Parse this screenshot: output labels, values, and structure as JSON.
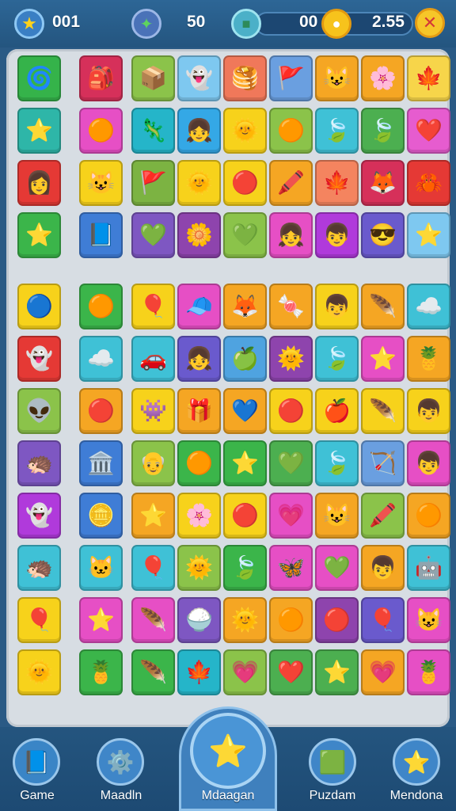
{
  "hud": {
    "score_label": "001",
    "moves_label": "50",
    "gold_label": "00",
    "time_label": "2.55",
    "icons": [
      "star-icon",
      "wrench-icon",
      "cube-icon",
      "gold-coin-icon",
      "close-icon"
    ]
  },
  "nav": {
    "items": [
      {
        "label": "Game",
        "icon": "book-icon"
      },
      {
        "label": "Maadln",
        "icon": "gear-icon"
      },
      {
        "label": "Mdaagan",
        "icon": "star-shield-icon"
      },
      {
        "label": "Puzdam",
        "icon": "puzzle-board-icon"
      },
      {
        "label": "Mendona",
        "icon": "star-icon"
      }
    ]
  },
  "board": {
    "rows": [
      [
        {
          "c": "#35b34a",
          "g": "🌀"
        },
        {
          "c": "#d6305a",
          "g": "🎒"
        },
        {
          "c": "#8bc34a",
          "g": "📦"
        },
        {
          "c": "#7ec8f0",
          "g": "👻"
        },
        {
          "c": "#f0785a",
          "g": "🥞"
        },
        {
          "c": "#6a9fe0",
          "g": "🚩"
        },
        {
          "c": "#f5a623",
          "g": "😺"
        },
        {
          "c": "#f5a623",
          "g": "🌸"
        },
        {
          "c": "#f7d54a",
          "g": "🍁"
        }
      ],
      [
        {
          "c": "#2eb6a8",
          "g": "⭐"
        },
        {
          "c": "#e64fc5",
          "g": "🟠"
        },
        {
          "c": "#25b5c9",
          "g": "🦎"
        },
        {
          "c": "#34a8e6",
          "g": "👧"
        },
        {
          "c": "#f7d21b",
          "g": "🌞"
        },
        {
          "c": "#8bc34a",
          "g": "🟠"
        },
        {
          "c": "#3fc1d6",
          "g": "🍃"
        },
        {
          "c": "#4caf50",
          "g": "🍃"
        },
        {
          "c": "#e65ccf",
          "g": "❤️"
        }
      ],
      [
        {
          "c": "#e53935",
          "g": "👩"
        },
        {
          "c": "#f7d21b",
          "g": "😺"
        },
        {
          "c": "#7cb342",
          "g": "🚩"
        },
        {
          "c": "#f7d21b",
          "g": "🌞"
        },
        {
          "c": "#f7d21b",
          "g": "🔴"
        },
        {
          "c": "#f5a623",
          "g": "🖍️"
        },
        {
          "c": "#f4845f",
          "g": "🍁"
        },
        {
          "c": "#d6305a",
          "g": "🦊"
        },
        {
          "c": "#e53935",
          "g": "🦀"
        }
      ],
      [
        {
          "c": "#3bb54a",
          "g": "⭐"
        },
        {
          "c": "#3f7dd6",
          "g": "📘"
        },
        {
          "c": "#7e57c2",
          "g": "💚"
        },
        {
          "c": "#8e44ad",
          "g": "🌼"
        },
        {
          "c": "#8bc34a",
          "g": "💚"
        },
        {
          "c": "#e64fc5",
          "g": "👧"
        },
        {
          "c": "#b03adb",
          "g": "👦"
        },
        {
          "c": "#6a5acd",
          "g": "😎"
        },
        {
          "c": "#7ec8f0",
          "g": "⭐"
        }
      ],
      [
        {
          "c": "#f7d21b",
          "g": "🔵"
        },
        {
          "c": "#3bb54a",
          "g": "🟠"
        },
        {
          "c": "#f7d21b",
          "g": "🎈"
        },
        {
          "c": "#e64fc5",
          "g": "🧢"
        },
        {
          "c": "#f5a623",
          "g": "🦊"
        },
        {
          "c": "#f5a623",
          "g": "🍬"
        },
        {
          "c": "#f7d21b",
          "g": "👦"
        },
        {
          "c": "#f5a623",
          "g": "🪶"
        },
        {
          "c": "#3fc1d6",
          "g": "☁️"
        }
      ],
      [
        {
          "c": "#e53935",
          "g": "👻"
        },
        {
          "c": "#3fc1d6",
          "g": "☁️"
        },
        {
          "c": "#3fc1d6",
          "g": "🚗"
        },
        {
          "c": "#6a5acd",
          "g": "👧"
        },
        {
          "c": "#4fa3e0",
          "g": "🍏"
        },
        {
          "c": "#8e44ad",
          "g": "🌞"
        },
        {
          "c": "#3fc1d6",
          "g": "🍃"
        },
        {
          "c": "#e64fc5",
          "g": "⭐"
        },
        {
          "c": "#f5a623",
          "g": "🍍"
        }
      ],
      [
        {
          "c": "#8bc34a",
          "g": "👽"
        },
        {
          "c": "#f5a623",
          "g": "🔴"
        },
        {
          "c": "#f7d21b",
          "g": "👾"
        },
        {
          "c": "#f5a623",
          "g": "🎁"
        },
        {
          "c": "#f5a623",
          "g": "💙"
        },
        {
          "c": "#f7d21b",
          "g": "🔴"
        },
        {
          "c": "#f7d21b",
          "g": "🍎"
        },
        {
          "c": "#f7d21b",
          "g": "🪶"
        },
        {
          "c": "#f7d21b",
          "g": "👦"
        }
      ],
      [
        {
          "c": "#7e57c2",
          "g": "🦔"
        },
        {
          "c": "#3f7dd6",
          "g": "🏛️"
        },
        {
          "c": "#8bc34a",
          "g": "👴"
        },
        {
          "c": "#3bb54a",
          "g": "🟠"
        },
        {
          "c": "#3bb54a",
          "g": "⭐"
        },
        {
          "c": "#4caf50",
          "g": "💚"
        },
        {
          "c": "#3fc1d6",
          "g": "🍃"
        },
        {
          "c": "#6a9fe0",
          "g": "🏹"
        },
        {
          "c": "#e64fc5",
          "g": "👦"
        }
      ],
      [
        {
          "c": "#b03adb",
          "g": "👻"
        },
        {
          "c": "#3f7dd6",
          "g": "🪙"
        },
        {
          "c": "#f5a623",
          "g": "⭐"
        },
        {
          "c": "#f7d21b",
          "g": "🌸"
        },
        {
          "c": "#f7d21b",
          "g": "🔴"
        },
        {
          "c": "#e64fc5",
          "g": "💗"
        },
        {
          "c": "#f5a623",
          "g": "😺"
        },
        {
          "c": "#8bc34a",
          "g": "🖍️"
        },
        {
          "c": "#f5a623",
          "g": "🟠"
        }
      ],
      [
        {
          "c": "#3fc1d6",
          "g": "🦔"
        },
        {
          "c": "#3fc1d6",
          "g": "🐱"
        },
        {
          "c": "#3fc1d6",
          "g": "🎈"
        },
        {
          "c": "#8bc34a",
          "g": "🌞"
        },
        {
          "c": "#3bb54a",
          "g": "🍃"
        },
        {
          "c": "#e64fc5",
          "g": "🦋"
        },
        {
          "c": "#e64fc5",
          "g": "💚"
        },
        {
          "c": "#f5a623",
          "g": "👦"
        },
        {
          "c": "#3fc1d6",
          "g": "🤖"
        }
      ],
      [
        {
          "c": "#f7d21b",
          "g": "🎈"
        },
        {
          "c": "#e64fc5",
          "g": "⭐"
        },
        {
          "c": "#e64fc5",
          "g": "🪶"
        },
        {
          "c": "#7e57c2",
          "g": "🍚"
        },
        {
          "c": "#f5a623",
          "g": "🌞"
        },
        {
          "c": "#f5a623",
          "g": "🟠"
        },
        {
          "c": "#8e44ad",
          "g": "🔴"
        },
        {
          "c": "#6a5acd",
          "g": "🎈"
        },
        {
          "c": "#e64fc5",
          "g": "😺"
        }
      ],
      [
        {
          "c": "#f7d21b",
          "g": "🌞"
        },
        {
          "c": "#3bb54a",
          "g": "🍍"
        },
        {
          "c": "#3bb54a",
          "g": "🪶"
        },
        {
          "c": "#25b5c9",
          "g": "🍁"
        },
        {
          "c": "#8bc34a",
          "g": "💗"
        },
        {
          "c": "#4caf50",
          "g": "❤️"
        },
        {
          "c": "#4caf50",
          "g": "⭐"
        },
        {
          "c": "#f5a623",
          "g": "💗"
        },
        {
          "c": "#e64fc5",
          "g": "🍍"
        }
      ]
    ]
  }
}
